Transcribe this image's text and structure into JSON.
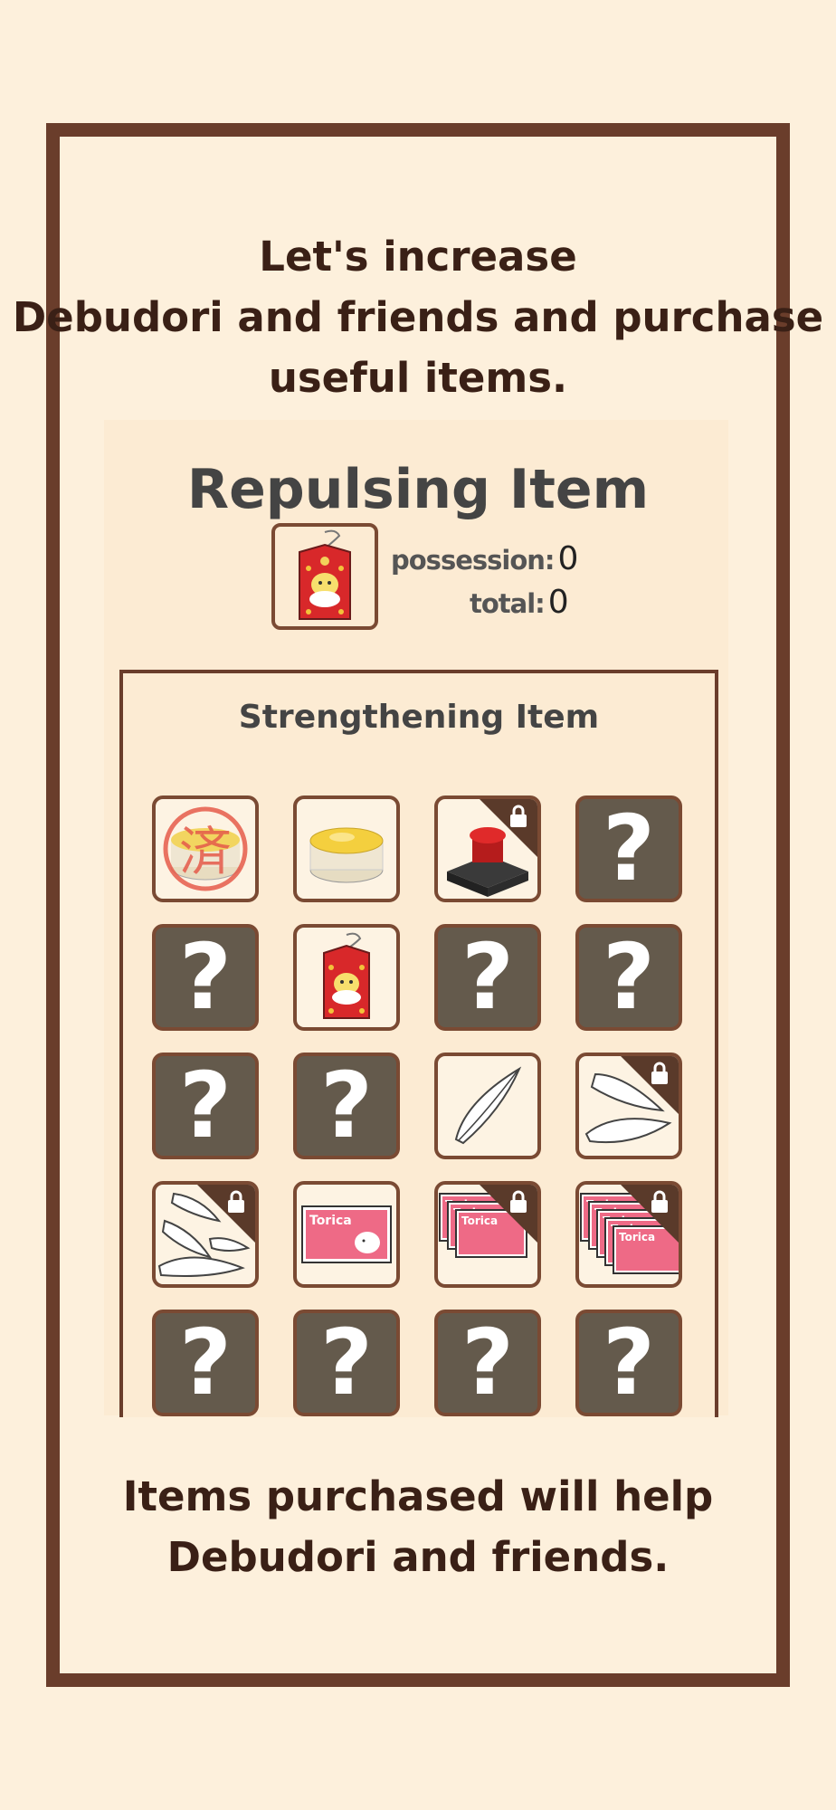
{
  "intro": {
    "line1": "Let's increase",
    "line2": "Debudori and friends and purchase",
    "line3": "useful items."
  },
  "repelling": {
    "title": "Repulsing Item",
    "possession_label": "possession:",
    "possession_value": "0",
    "total_label": "total:",
    "total_value": "0"
  },
  "strengthening": {
    "title": "Strengthening Item",
    "items": [
      {
        "icon": "stamped-pudding-icon",
        "state": "used"
      },
      {
        "icon": "pudding-icon",
        "state": "available"
      },
      {
        "icon": "stamp-button-icon",
        "state": "locked"
      },
      {
        "icon": "unknown-icon",
        "state": "unknown",
        "label": "?"
      },
      {
        "icon": "unknown-icon",
        "state": "unknown",
        "label": "?"
      },
      {
        "icon": "omamori-charm-icon",
        "state": "available"
      },
      {
        "icon": "unknown-icon",
        "state": "unknown",
        "label": "?"
      },
      {
        "icon": "unknown-icon",
        "state": "unknown",
        "label": "?"
      },
      {
        "icon": "unknown-icon",
        "state": "unknown",
        "label": "?"
      },
      {
        "icon": "unknown-icon",
        "state": "unknown",
        "label": "?"
      },
      {
        "icon": "feather-icon",
        "state": "available"
      },
      {
        "icon": "two-feathers-icon",
        "state": "locked"
      },
      {
        "icon": "many-feathers-icon",
        "state": "locked"
      },
      {
        "icon": "torica-card-icon",
        "state": "available",
        "label": "Torica"
      },
      {
        "icon": "three-torica-cards-icon",
        "state": "locked",
        "label": "Torica"
      },
      {
        "icon": "many-torica-cards-icon",
        "state": "locked",
        "label": "Torica"
      },
      {
        "icon": "unknown-icon",
        "state": "unknown",
        "label": "?"
      },
      {
        "icon": "unknown-icon",
        "state": "unknown",
        "label": "?"
      },
      {
        "icon": "unknown-icon",
        "state": "unknown",
        "label": "?"
      },
      {
        "icon": "unknown-icon",
        "state": "unknown",
        "label": "?"
      }
    ]
  },
  "outro": {
    "line1": "Items purchased will help",
    "line2": "Debudori and friends."
  },
  "colors": {
    "background": "#fdf0dc",
    "frame": "#6a3d2b",
    "unknown_tile": "#645a4c",
    "text": "#3a2016"
  }
}
